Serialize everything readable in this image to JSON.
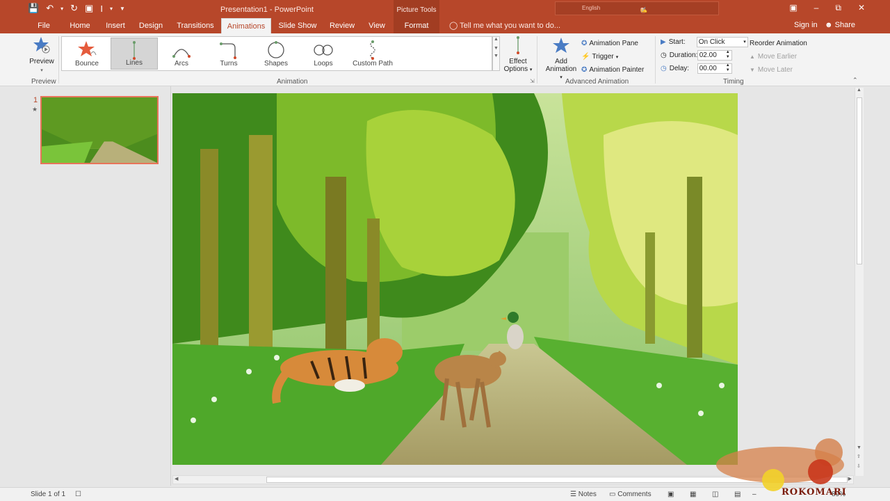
{
  "window": {
    "title": "Presentation1 - PowerPoint",
    "context_group": "Picture Tools",
    "language_label": "English"
  },
  "tabs": {
    "file": "File",
    "home": "Home",
    "insert": "Insert",
    "design": "Design",
    "transitions": "Transitions",
    "animations": "Animations",
    "slideshow": "Slide Show",
    "review": "Review",
    "view": "View",
    "format": "Format",
    "tell_me": "Tell me what you want to do...",
    "sign_in": "Sign in",
    "share": "Share"
  },
  "ribbon": {
    "preview": {
      "label": "Preview",
      "group": "Preview"
    },
    "animation_group": "Animation",
    "gallery": [
      {
        "label": "Bounce",
        "icon": "bounce-star-icon"
      },
      {
        "label": "Lines",
        "icon": "lines-path-icon",
        "selected": true
      },
      {
        "label": "Arcs",
        "icon": "arcs-path-icon"
      },
      {
        "label": "Turns",
        "icon": "turns-path-icon"
      },
      {
        "label": "Shapes",
        "icon": "shapes-path-icon"
      },
      {
        "label": "Loops",
        "icon": "loops-path-icon"
      },
      {
        "label": "Custom Path",
        "icon": "custom-path-icon"
      }
    ],
    "effect_options": {
      "line1": "Effect",
      "line2": "Options"
    },
    "add_animation": {
      "line1": "Add",
      "line2": "Animation"
    },
    "advanced": {
      "group": "Advanced Animation",
      "pane": "Animation Pane",
      "trigger": "Trigger",
      "painter": "Animation Painter"
    },
    "timing": {
      "group": "Timing",
      "start_label": "Start:",
      "start_value": "On Click",
      "duration_label": "Duration:",
      "duration_value": "02.00",
      "delay_label": "Delay:",
      "delay_value": "00.00",
      "reorder": "Reorder Animation",
      "move_earlier": "Move Earlier",
      "move_later": "Move Later"
    }
  },
  "slides_panel": {
    "number": "1",
    "anim_marker": "★"
  },
  "status": {
    "slide_info": "Slide 1 of 1",
    "notes": "Notes",
    "comments": "Comments",
    "zoom": "89%"
  },
  "watermark": "ROKOMARI",
  "colors": {
    "accent": "#b7472a",
    "ribbon_bg": "#f3f3f3",
    "thumb_border": "#e8745a"
  }
}
